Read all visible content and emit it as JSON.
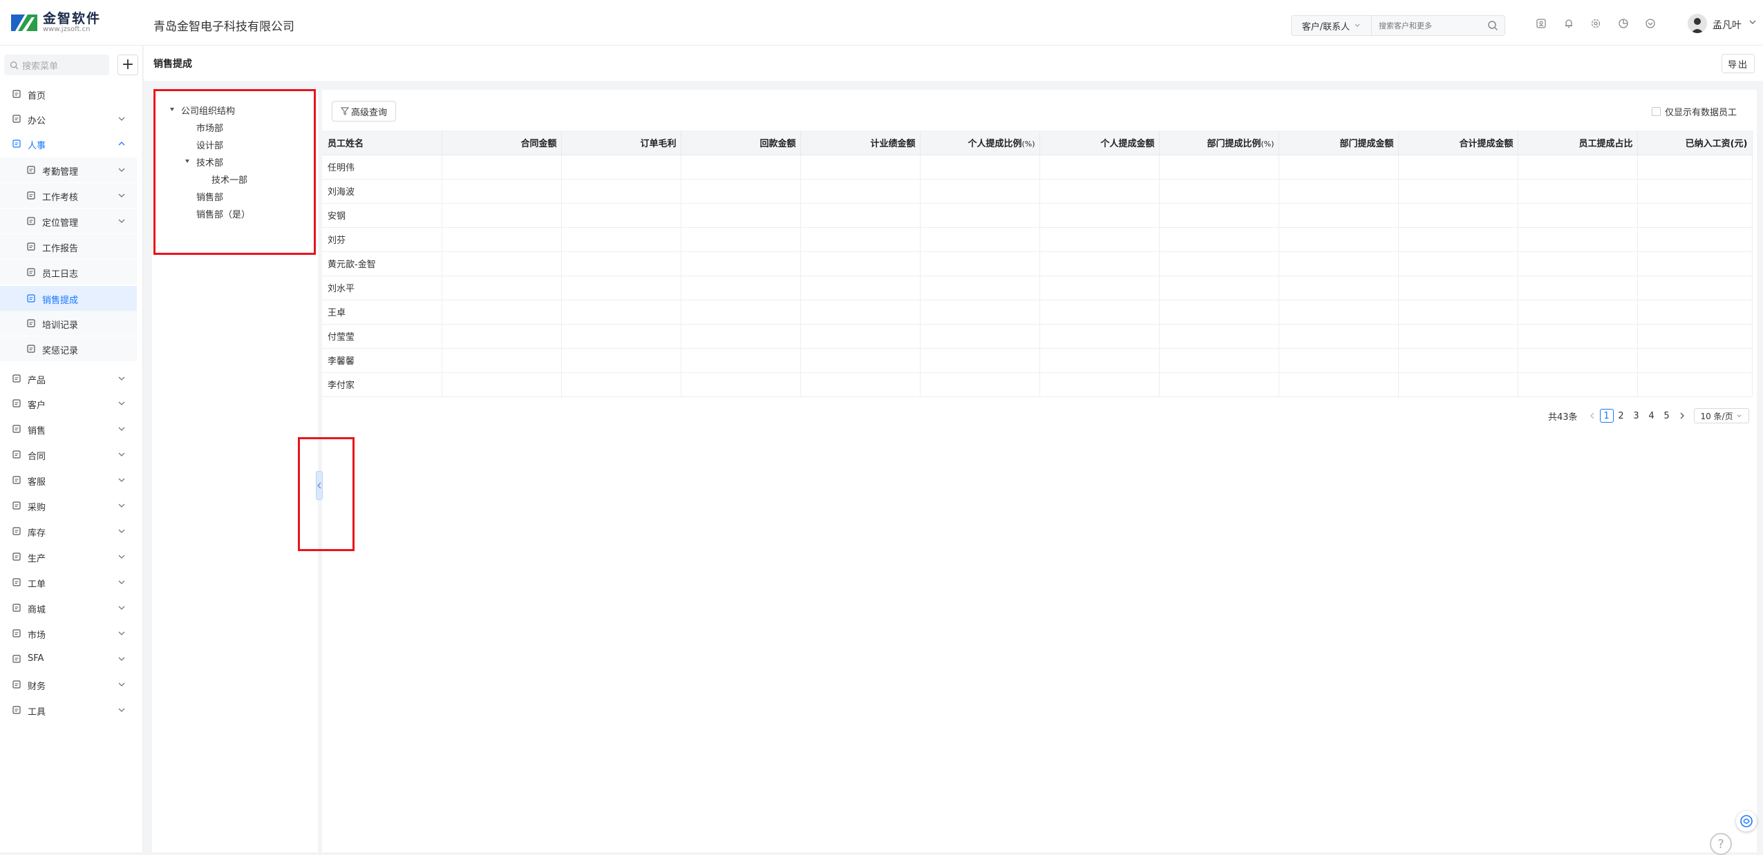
{
  "header": {
    "logo_name": "金智软件",
    "logo_url": "www.jzsoft.cn",
    "company": "青岛金智电子科技有限公司",
    "search_type": "客户/联系人",
    "search_placeholder": "搜索客户和更多",
    "username": "孟凡叶"
  },
  "sidebar": {
    "search_placeholder": "搜索菜单",
    "items": [
      {
        "label": "首页",
        "icon": "home-icon"
      },
      {
        "label": "办公",
        "icon": "office-icon"
      },
      {
        "label": "人事",
        "icon": "hr-icon"
      },
      {
        "label": "考勤管理",
        "icon": "attendance-icon"
      },
      {
        "label": "工作考核",
        "icon": "assessment-icon"
      },
      {
        "label": "定位管理",
        "icon": "location-icon"
      },
      {
        "label": "工作报告",
        "icon": "report-icon"
      },
      {
        "label": "员工日志",
        "icon": "log-icon"
      },
      {
        "label": "销售提成",
        "icon": "commission-icon"
      },
      {
        "label": "培训记录",
        "icon": "training-icon"
      },
      {
        "label": "奖惩记录",
        "icon": "reward-icon"
      },
      {
        "label": "产品",
        "icon": "product-icon"
      },
      {
        "label": "客户",
        "icon": "customer-icon"
      },
      {
        "label": "销售",
        "icon": "sales-icon"
      },
      {
        "label": "合同",
        "icon": "contract-icon"
      },
      {
        "label": "客服",
        "icon": "service-icon"
      },
      {
        "label": "采购",
        "icon": "purchase-icon"
      },
      {
        "label": "库存",
        "icon": "inventory-icon"
      },
      {
        "label": "生产",
        "icon": "production-icon"
      },
      {
        "label": "工单",
        "icon": "workorder-icon"
      },
      {
        "label": "商城",
        "icon": "mall-icon"
      },
      {
        "label": "市场",
        "icon": "market-icon"
      },
      {
        "label": "SFA",
        "icon": "sfa-icon"
      },
      {
        "label": "财务",
        "icon": "finance-icon"
      },
      {
        "label": "工具",
        "icon": "tools-icon"
      }
    ]
  },
  "page": {
    "title": "销售提成",
    "export_label": "导出",
    "adv_query_label": "高级查询",
    "only_data_label": "仅显示有数据员工"
  },
  "tree": {
    "root": "公司组织结构",
    "nodes": [
      "市场部",
      "设计部",
      "技术部",
      "技术一部",
      "销售部",
      "销售部（是）"
    ]
  },
  "table": {
    "columns": [
      "员工姓名",
      "合同金额",
      "订单毛利",
      "回款金额",
      "计业绩金额",
      "个人提成比例",
      "个人提成金额",
      "部门提成比例",
      "部门提成金额",
      "合计提成金额",
      "员工提成占比",
      "已纳入工资(元)"
    ],
    "pct_suffix": "(%)",
    "rows": [
      "任明伟",
      "刘海波",
      "安钢",
      "刘芬",
      "黄元歆-金智",
      "刘水平",
      "王卓",
      "付莹莹",
      "李馨馨",
      "李付家"
    ]
  },
  "pager": {
    "total": "共43条",
    "pages": [
      "1",
      "2",
      "3",
      "4",
      "5"
    ],
    "current": "1",
    "page_size": "10 条/页"
  },
  "colors": {
    "accent": "#1677ff",
    "highlight": "#e8141c"
  }
}
